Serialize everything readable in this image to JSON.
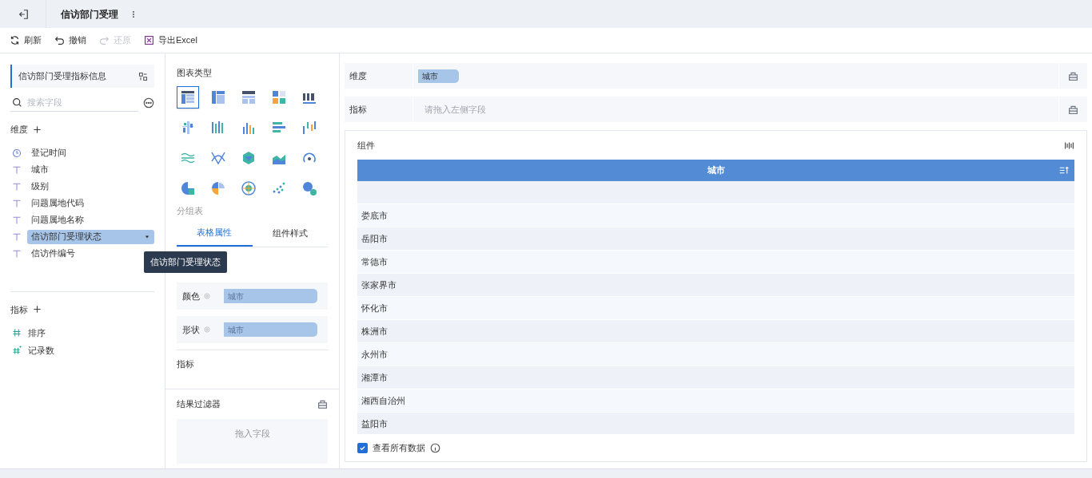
{
  "tab": {
    "title": "信访部门受理"
  },
  "toolbar": [
    {
      "label": "刷新",
      "kind": "refresh",
      "disabled": false
    },
    {
      "label": "撤销",
      "kind": "undo",
      "disabled": false
    },
    {
      "label": "还原",
      "kind": "redo",
      "disabled": true
    },
    {
      "label": "导出Excel",
      "kind": "excel",
      "disabled": false
    }
  ],
  "dataset": {
    "title": "信访部门受理指标信息",
    "search_placeholder": "搜索字段"
  },
  "dimensions": {
    "title": "维度",
    "fields": [
      {
        "label": "登记时间",
        "kind": "time",
        "selected": false
      },
      {
        "label": "城市",
        "kind": "text",
        "selected": false
      },
      {
        "label": "级别",
        "kind": "text",
        "selected": false
      },
      {
        "label": "问题属地代码",
        "kind": "text",
        "selected": false
      },
      {
        "label": "问题属地名称",
        "kind": "text",
        "selected": false
      },
      {
        "label": "信访部门受理状态",
        "kind": "text",
        "selected": true
      },
      {
        "label": "信访件编号",
        "kind": "text",
        "selected": false
      }
    ]
  },
  "measures": {
    "title": "指标",
    "fields": [
      {
        "label": "排序",
        "kind": "number"
      },
      {
        "label": "记录数",
        "kind": "count"
      }
    ]
  },
  "tooltip": "信访部门受理状态",
  "chart_types": {
    "title": "图表类型",
    "items": [
      {
        "selected": true
      },
      {
        "selected": false
      },
      {
        "selected": false
      },
      {
        "selected": false
      },
      {
        "selected": false
      },
      {
        "selected": false
      },
      {
        "selected": false
      },
      {
        "selected": false
      },
      {
        "selected": false
      },
      {
        "selected": false
      },
      {
        "selected": false
      },
      {
        "selected": false
      },
      {
        "selected": false
      },
      {
        "selected": false
      },
      {
        "selected": false
      },
      {
        "selected": false
      },
      {
        "selected": false
      },
      {
        "selected": false
      },
      {
        "selected": false
      },
      {
        "selected": false
      }
    ],
    "current": "分组表"
  },
  "property_tabs": [
    {
      "label": "表格属性",
      "selected": true
    },
    {
      "label": "组件样式",
      "selected": false
    }
  ],
  "properties": [
    {
      "label": "颜色",
      "value": "城市"
    },
    {
      "label": "形状",
      "value": "城市"
    }
  ],
  "measure_section": "指标",
  "filter": {
    "title": "结果过滤器",
    "placeholder": "拖入字段"
  },
  "shelves": [
    {
      "label": "维度",
      "value": "城市"
    },
    {
      "label": "指标",
      "placeholder": "请拖入左侧字段"
    }
  ],
  "component": {
    "title": "组件",
    "column": "城市",
    "rows": [
      "",
      "娄底市",
      "岳阳市",
      "常德市",
      "张家界市",
      "怀化市",
      "株洲市",
      "永州市",
      "湘潭市",
      "湘西自治州",
      "益阳市"
    ],
    "show_all": {
      "label": "查看所有数据",
      "checked": true
    }
  }
}
